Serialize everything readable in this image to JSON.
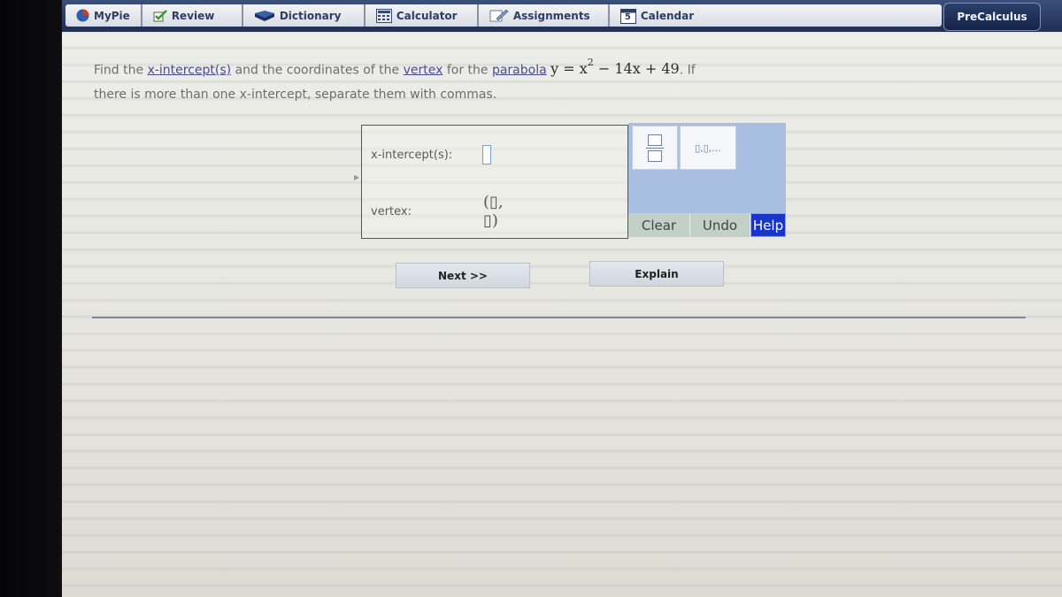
{
  "nav": {
    "items": [
      {
        "label": "MyPie",
        "icon": "pie-chart-icon"
      },
      {
        "label": "Review",
        "icon": "checkmark-icon"
      },
      {
        "label": "Dictionary",
        "icon": "book-icon"
      },
      {
        "label": "Calculator",
        "icon": "calculator-icon"
      },
      {
        "label": "Assignments",
        "icon": "pencil-icon"
      },
      {
        "label": "Calendar",
        "icon": "calendar-icon",
        "badge": "5"
      }
    ],
    "brand": "PreCalculus"
  },
  "question": {
    "part1": "Find the ",
    "term_intercepts": "x-intercept(s)",
    "part2": " and the coordinates of the ",
    "term_vertex": "vertex",
    "part3": " for the ",
    "term_parabola": "parabola",
    "equation_lhs": "y = x",
    "equation_exp": "2",
    "equation_rhs": " − 14x + 49",
    "part4": ". If",
    "line2": "there is more than one x-intercept, separate them with commas."
  },
  "answer": {
    "intercept_label": "x-intercept(s):",
    "intercept_value": "",
    "vertex_label": "vertex:",
    "vertex_template": "(▯, ▯)"
  },
  "palette": {
    "list_label": "▯,▯,...",
    "clear_label": "Clear",
    "undo_label": "Undo",
    "help_label": "Help"
  },
  "buttons": {
    "next_label": "Next >>",
    "explain_label": "Explain"
  },
  "colors": {
    "nav_background": "#1f2f55",
    "help_background": "#1a36c8",
    "palette_background": "#a9bfe1"
  }
}
